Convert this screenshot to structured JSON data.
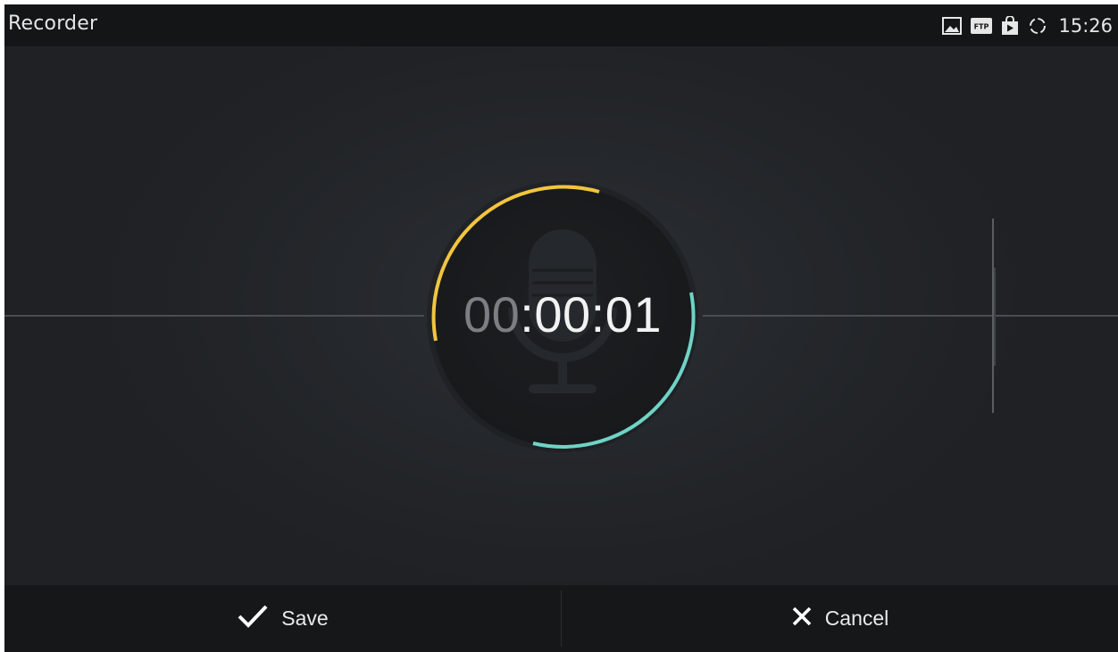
{
  "statusbar": {
    "app_title": "Recorder",
    "icons": [
      "image-icon",
      "ftp-icon",
      "store-bag-icon",
      "sync-icon"
    ],
    "ftp_label": "FTP",
    "clock": "15:26"
  },
  "recorder": {
    "timer_hours": "00",
    "timer_rest": ":00:01",
    "progress_colors": {
      "start": "#f2c53d",
      "end": "#6fd3c6"
    },
    "center_icon": "microphone-icon"
  },
  "actions": {
    "save_label": "Save",
    "save_icon": "check-icon",
    "cancel_label": "Cancel",
    "cancel_icon": "close-icon"
  }
}
